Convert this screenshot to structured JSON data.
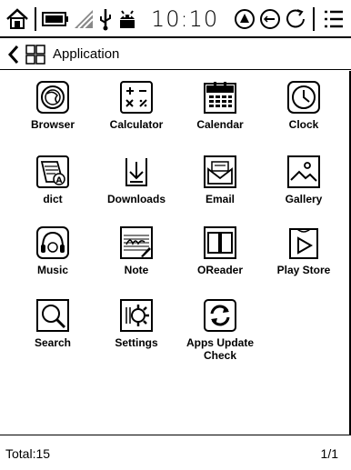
{
  "statusbar": {
    "time": "10:10",
    "icons": [
      "home-icon",
      "battery-icon",
      "wifi-icon",
      "usb-icon",
      "android-debug-icon",
      "rotate-icon",
      "volume-icon",
      "refresh-icon",
      "menu-icon"
    ]
  },
  "header": {
    "title": "Application",
    "back_icon": "chevron-left-icon",
    "apps_icon": "apps-grid-icon"
  },
  "apps": [
    {
      "label": "Browser",
      "icon": "browser-icon"
    },
    {
      "label": "Calculator",
      "icon": "calculator-icon"
    },
    {
      "label": "Calendar",
      "icon": "calendar-icon"
    },
    {
      "label": "Clock",
      "icon": "clock-icon"
    },
    {
      "label": "dict",
      "icon": "dict-icon"
    },
    {
      "label": "Downloads",
      "icon": "downloads-icon"
    },
    {
      "label": "Email",
      "icon": "email-icon"
    },
    {
      "label": "Gallery",
      "icon": "gallery-icon"
    },
    {
      "label": "Music",
      "icon": "music-icon"
    },
    {
      "label": "Note",
      "icon": "note-icon"
    },
    {
      "label": "OReader",
      "icon": "oreader-icon"
    },
    {
      "label": "Play Store",
      "icon": "play-store-icon"
    },
    {
      "label": "Search",
      "icon": "search-icon"
    },
    {
      "label": "Settings",
      "icon": "settings-icon"
    },
    {
      "label": "Apps Update Check",
      "icon": "update-icon"
    }
  ],
  "footer": {
    "total": "Total:15",
    "page": "1/1"
  }
}
